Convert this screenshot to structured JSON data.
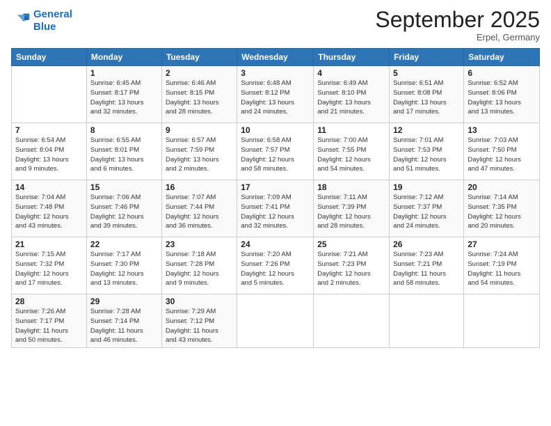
{
  "header": {
    "logo_line1": "General",
    "logo_line2": "Blue",
    "title": "September 2025",
    "location": "Erpel, Germany"
  },
  "weekdays": [
    "Sunday",
    "Monday",
    "Tuesday",
    "Wednesday",
    "Thursday",
    "Friday",
    "Saturday"
  ],
  "weeks": [
    [
      {
        "day": "",
        "info": ""
      },
      {
        "day": "1",
        "info": "Sunrise: 6:45 AM\nSunset: 8:17 PM\nDaylight: 13 hours\nand 32 minutes."
      },
      {
        "day": "2",
        "info": "Sunrise: 6:46 AM\nSunset: 8:15 PM\nDaylight: 13 hours\nand 28 minutes."
      },
      {
        "day": "3",
        "info": "Sunrise: 6:48 AM\nSunset: 8:12 PM\nDaylight: 13 hours\nand 24 minutes."
      },
      {
        "day": "4",
        "info": "Sunrise: 6:49 AM\nSunset: 8:10 PM\nDaylight: 13 hours\nand 21 minutes."
      },
      {
        "day": "5",
        "info": "Sunrise: 6:51 AM\nSunset: 8:08 PM\nDaylight: 13 hours\nand 17 minutes."
      },
      {
        "day": "6",
        "info": "Sunrise: 6:52 AM\nSunset: 8:06 PM\nDaylight: 13 hours\nand 13 minutes."
      }
    ],
    [
      {
        "day": "7",
        "info": "Sunrise: 6:54 AM\nSunset: 8:04 PM\nDaylight: 13 hours\nand 9 minutes."
      },
      {
        "day": "8",
        "info": "Sunrise: 6:55 AM\nSunset: 8:01 PM\nDaylight: 13 hours\nand 6 minutes."
      },
      {
        "day": "9",
        "info": "Sunrise: 6:57 AM\nSunset: 7:59 PM\nDaylight: 13 hours\nand 2 minutes."
      },
      {
        "day": "10",
        "info": "Sunrise: 6:58 AM\nSunset: 7:57 PM\nDaylight: 12 hours\nand 58 minutes."
      },
      {
        "day": "11",
        "info": "Sunrise: 7:00 AM\nSunset: 7:55 PM\nDaylight: 12 hours\nand 54 minutes."
      },
      {
        "day": "12",
        "info": "Sunrise: 7:01 AM\nSunset: 7:53 PM\nDaylight: 12 hours\nand 51 minutes."
      },
      {
        "day": "13",
        "info": "Sunrise: 7:03 AM\nSunset: 7:50 PM\nDaylight: 12 hours\nand 47 minutes."
      }
    ],
    [
      {
        "day": "14",
        "info": "Sunrise: 7:04 AM\nSunset: 7:48 PM\nDaylight: 12 hours\nand 43 minutes."
      },
      {
        "day": "15",
        "info": "Sunrise: 7:06 AM\nSunset: 7:46 PM\nDaylight: 12 hours\nand 39 minutes."
      },
      {
        "day": "16",
        "info": "Sunrise: 7:07 AM\nSunset: 7:44 PM\nDaylight: 12 hours\nand 36 minutes."
      },
      {
        "day": "17",
        "info": "Sunrise: 7:09 AM\nSunset: 7:41 PM\nDaylight: 12 hours\nand 32 minutes."
      },
      {
        "day": "18",
        "info": "Sunrise: 7:11 AM\nSunset: 7:39 PM\nDaylight: 12 hours\nand 28 minutes."
      },
      {
        "day": "19",
        "info": "Sunrise: 7:12 AM\nSunset: 7:37 PM\nDaylight: 12 hours\nand 24 minutes."
      },
      {
        "day": "20",
        "info": "Sunrise: 7:14 AM\nSunset: 7:35 PM\nDaylight: 12 hours\nand 20 minutes."
      }
    ],
    [
      {
        "day": "21",
        "info": "Sunrise: 7:15 AM\nSunset: 7:32 PM\nDaylight: 12 hours\nand 17 minutes."
      },
      {
        "day": "22",
        "info": "Sunrise: 7:17 AM\nSunset: 7:30 PM\nDaylight: 12 hours\nand 13 minutes."
      },
      {
        "day": "23",
        "info": "Sunrise: 7:18 AM\nSunset: 7:28 PM\nDaylight: 12 hours\nand 9 minutes."
      },
      {
        "day": "24",
        "info": "Sunrise: 7:20 AM\nSunset: 7:26 PM\nDaylight: 12 hours\nand 5 minutes."
      },
      {
        "day": "25",
        "info": "Sunrise: 7:21 AM\nSunset: 7:23 PM\nDaylight: 12 hours\nand 2 minutes."
      },
      {
        "day": "26",
        "info": "Sunrise: 7:23 AM\nSunset: 7:21 PM\nDaylight: 11 hours\nand 58 minutes."
      },
      {
        "day": "27",
        "info": "Sunrise: 7:24 AM\nSunset: 7:19 PM\nDaylight: 11 hours\nand 54 minutes."
      }
    ],
    [
      {
        "day": "28",
        "info": "Sunrise: 7:26 AM\nSunset: 7:17 PM\nDaylight: 11 hours\nand 50 minutes."
      },
      {
        "day": "29",
        "info": "Sunrise: 7:28 AM\nSunset: 7:14 PM\nDaylight: 11 hours\nand 46 minutes."
      },
      {
        "day": "30",
        "info": "Sunrise: 7:29 AM\nSunset: 7:12 PM\nDaylight: 11 hours\nand 43 minutes."
      },
      {
        "day": "",
        "info": ""
      },
      {
        "day": "",
        "info": ""
      },
      {
        "day": "",
        "info": ""
      },
      {
        "day": "",
        "info": ""
      }
    ]
  ]
}
